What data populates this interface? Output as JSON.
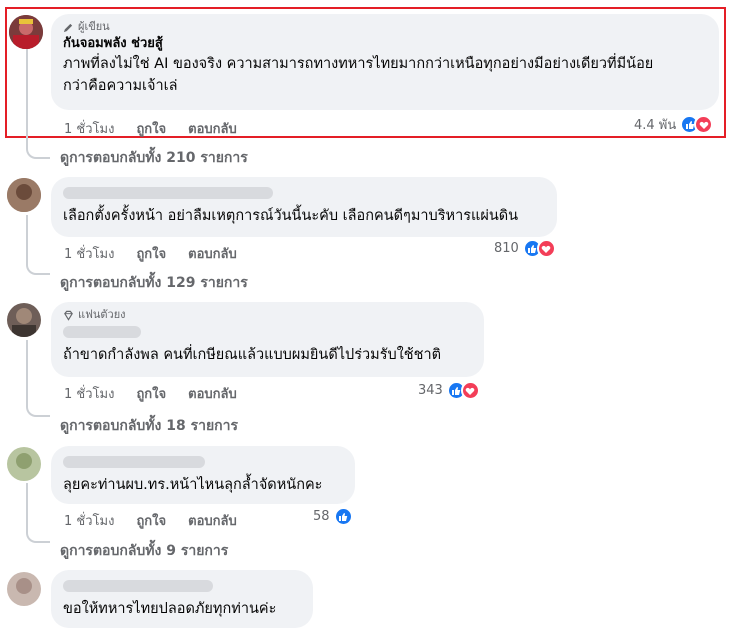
{
  "colors": {
    "accent": "#1877f2",
    "love": "#f33e58",
    "highlight": "#e41e26",
    "bubble": "#f0f2f5"
  },
  "comments": [
    {
      "badge_icon": "pencil-icon",
      "badge": "ผู้เขียน",
      "author": "กันจอมพลัง ช่วยสู้",
      "text_lines": [
        "ภาพที่ลงไม่ใช่ AI ของจริง ความสามารถทางทหารไทยมากกว่าเหนือทุกอย่างมีอย่างเดียวที่มีน้อย",
        "กว่าคือความเจ้าเล่"
      ],
      "time": "1 ชั่วโมง",
      "like": "ถูกใจ",
      "reply": "ตอบกลับ",
      "reactions": "4.4 พัน",
      "view_replies": "ดูการตอบกลับทั้ง 210 รายการ"
    },
    {
      "text_lines": [
        "เลือกตั้งครั้งหน้า อย่าลืมเหตุการณ์วันนี้นะคับ เลือกคนดีๆมาบริหารแผ่นดิน"
      ],
      "time": "1 ชั่วโมง",
      "like": "ถูกใจ",
      "reply": "ตอบกลับ",
      "reactions": "810",
      "view_replies": "ดูการตอบกลับทั้ง 129 รายการ"
    },
    {
      "badge_icon": "diamond-icon",
      "badge": "แฟนตัวยง",
      "text_lines": [
        "ถ้าขาดกำลังพล คนที่เกษียณแล้วแบบผมยินดีไปร่วมรับใช้ชาติ"
      ],
      "time": "1 ชั่วโมง",
      "like": "ถูกใจ",
      "reply": "ตอบกลับ",
      "reactions": "343",
      "view_replies": "ดูการตอบกลับทั้ง 18 รายการ"
    },
    {
      "text_lines": [
        "ลุยคะท่านผบ.ทร.หน้าไหนลุกล้ำจัดหนักคะ"
      ],
      "time": "1 ชั่วโมง",
      "like": "ถูกใจ",
      "reply": "ตอบกลับ",
      "reactions": "58",
      "view_replies": "ดูการตอบกลับทั้ง 9 รายการ"
    },
    {
      "text_lines": [
        "ขอให้ทหารไทยปลอดภัยทุกท่านค่ะ"
      ]
    }
  ]
}
